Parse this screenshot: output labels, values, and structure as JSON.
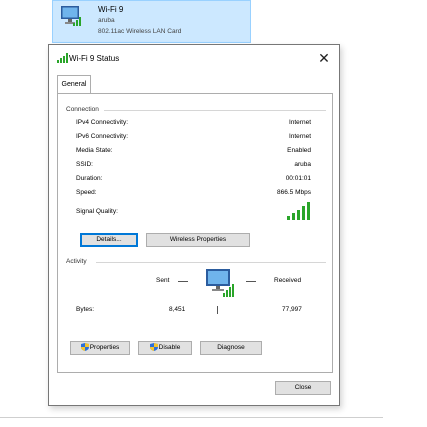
{
  "adapter": {
    "name": "Wi-Fi 9",
    "network": "aruba",
    "device": "802.11ac Wireless LAN Card"
  },
  "dialog": {
    "title": "Wi-Fi 9 Status",
    "close_glyph": "✕",
    "tab_general": "General",
    "connection": {
      "heading": "Connection",
      "rows": [
        {
          "label": "IPv4 Connectivity:",
          "value": "Internet"
        },
        {
          "label": "IPv6 Connectivity:",
          "value": "Internet"
        },
        {
          "label": "Media State:",
          "value": "Enabled"
        },
        {
          "label": "SSID:",
          "value": "aruba"
        },
        {
          "label": "Duration:",
          "value": "00:01:01"
        },
        {
          "label": "Speed:",
          "value": "866.5 Mbps"
        }
      ],
      "signal_label": "Signal Quality:",
      "signal_bars": 5
    },
    "details_button": "Details...",
    "wireless_props_button": "Wireless Properties",
    "activity": {
      "heading": "Activity",
      "sent": "Sent",
      "received": "Received",
      "bytes_label": "Bytes:",
      "bytes_sent": "8,451",
      "bytes_received": "77,997"
    },
    "properties_button": "Properties",
    "disable_button": "Disable",
    "diagnose_button": "Diagnose",
    "close_button": "Close"
  },
  "colors": {
    "accent": "#0078d7",
    "signal_green": "#2aa52a",
    "selection_bg": "#cce8ff"
  }
}
